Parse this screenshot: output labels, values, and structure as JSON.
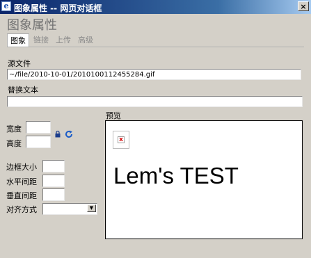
{
  "window": {
    "title": "图象属性  --  网页对话框",
    "close_label": "×"
  },
  "dialog": {
    "title": "图象属性"
  },
  "tabs": [
    {
      "label": "图象",
      "active": true
    },
    {
      "label": "链接",
      "active": false
    },
    {
      "label": "上传",
      "active": false
    },
    {
      "label": "高级",
      "active": false
    }
  ],
  "form": {
    "source_label": "源文件",
    "source_value": "~/file/2010-10-01/2010100112455284.gif",
    "alt_label": "替换文本",
    "alt_value": "",
    "width_label": "宽度",
    "width_value": "",
    "height_label": "高度",
    "height_value": "",
    "border_label": "边框大小",
    "border_value": "",
    "hspace_label": "水平间距",
    "hspace_value": "",
    "vspace_label": "垂直间距",
    "vspace_value": "",
    "align_label": "对齐方式",
    "align_value": ""
  },
  "preview": {
    "label": "预览",
    "text": "Lem's TEST"
  },
  "colors": {
    "title_gradient_start": "#0a246a",
    "title_gradient_end": "#a6caf0",
    "dialog_bg": "#d4d0c8",
    "broken_image_x": "#d40000"
  }
}
